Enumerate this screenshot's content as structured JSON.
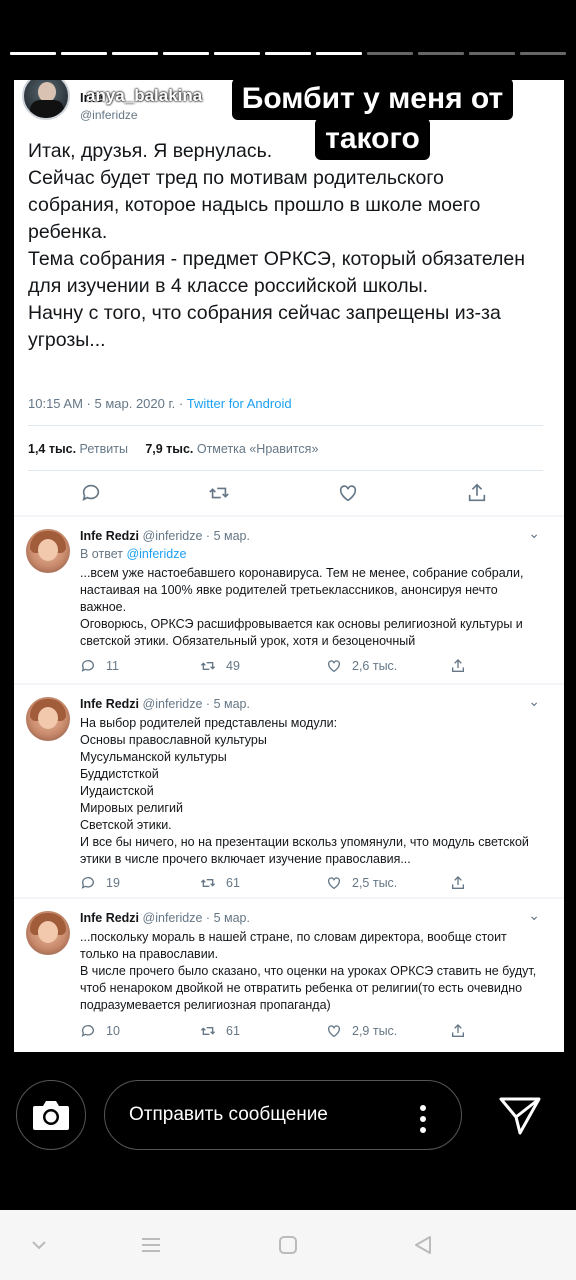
{
  "story": {
    "progress_total": 12,
    "progress_done": 7,
    "username": "anya_balakina",
    "caption_line1": "Бомбит у меня от",
    "caption_line2": "такого"
  },
  "tweet": {
    "author_name": "Infe",
    "author_handle": "@inferidze",
    "text": "Итак, друзья. Я вернулась.\nСейчас будет тред по мотивам родительского собрания, которое надысь прошло в школе моего ребенка.\nТема собрания - предмет ОРКСЭ, который обязателен для изучении в 4 классе российской школы.\nНачну с того, что собрания сейчас запрещены из-за угрозы...",
    "time": "10:15 AM · 5 мар. 2020 г. · ",
    "client": "Twitter for Android",
    "retweets_count": "1,4 тыс.",
    "retweets_label": " Ретвиты",
    "likes_count": "7,9 тыс.",
    "likes_label": " Отметка «Нравится»"
  },
  "replies": [
    {
      "name": "Infe Redzi",
      "meta": " @inferidze · 5 мар.",
      "in_reply_prefix": "В ответ ",
      "in_reply_handle": "@inferidze",
      "text": "...всем уже настоебавшего коронавируса. Тем не менее, собрание собрали, настаивая на 100% явке родителей третьеклассников, анонсируя нечто важное.\nОговорюсь, ОРКСЭ расшифровывается как основы религиозной культуры и светской этики. Обязательный урок, хотя и безоценочный",
      "replies": "11",
      "retweets": "49",
      "likes": "2,6 тыс."
    },
    {
      "name": "Infe Redzi",
      "meta": " @inferidze · 5 мар.",
      "text": "На выбор родителей представлены модули:\nОсновы православной культуры\nМусульманской культуры\nБуддистсткой\nИудаистской\nМировых религий\nСветской этики.\nИ все бы ничего, но на презентации вскольз упомянули, что модуль светской этики в числе прочего включает изучение православия...",
      "replies": "19",
      "retweets": "61",
      "likes": "2,5 тыс."
    },
    {
      "name": "Infe Redzi",
      "meta": " @inferidze · 5 мар.",
      "text": "...поскольку мораль в нашей стране, по словам директора, вообще стоит только на православии.\nВ числе прочего было сказано, что оценки на уроках ОРКСЭ ставить не будут, чтоб ненароком двойкой не отвратить ребенка от религии(то есть очевидно подразумевается религиозная пропаганда)",
      "replies": "10",
      "retweets": "61",
      "likes": "2,9 тыс."
    }
  ],
  "composer": {
    "placeholder": "Отправить сообщение"
  },
  "icons": [
    "camera-icon",
    "more-icon",
    "send-icon",
    "reply-icon",
    "retweet-icon",
    "like-icon",
    "share-icon",
    "nav-menu-icon",
    "nav-home-icon",
    "nav-back-icon",
    "nav-down-icon"
  ]
}
